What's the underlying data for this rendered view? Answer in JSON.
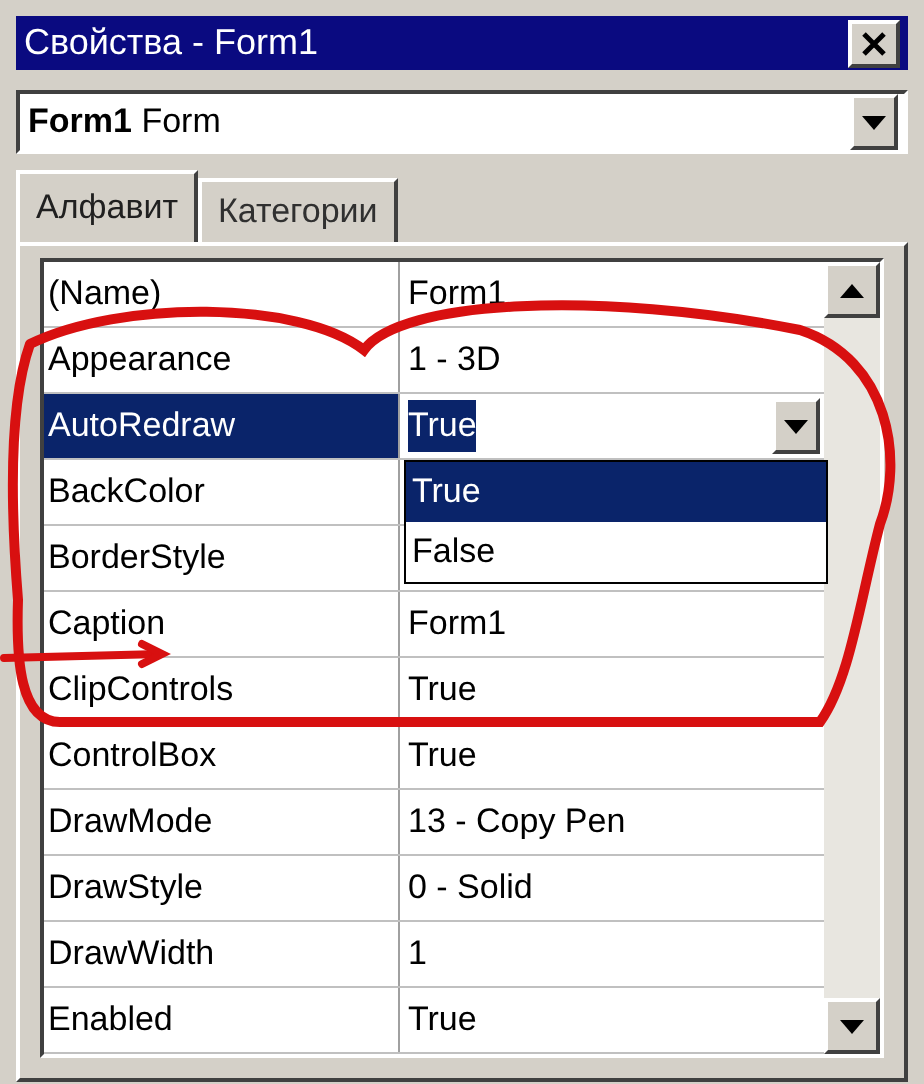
{
  "window": {
    "title": "Свойства - Form1"
  },
  "object_selector": {
    "name": "Form1",
    "type": "Form"
  },
  "tabs": [
    {
      "label": "Алфавит",
      "selected": true
    },
    {
      "label": "Категории",
      "selected": false
    }
  ],
  "properties": [
    {
      "name": "(Name)",
      "value": "Form1",
      "selected": false
    },
    {
      "name": "Appearance",
      "value": "1 - 3D",
      "selected": false
    },
    {
      "name": "AutoRedraw",
      "value": "True",
      "selected": true
    },
    {
      "name": "BackColor",
      "selected": false
    },
    {
      "name": "BorderStyle",
      "selected": false
    },
    {
      "name": "Caption",
      "value": "Form1",
      "selected": false
    },
    {
      "name": "ClipControls",
      "value": "True",
      "selected": false
    },
    {
      "name": "ControlBox",
      "value": "True",
      "selected": false
    },
    {
      "name": "DrawMode",
      "value": "13 - Copy Pen",
      "selected": false
    },
    {
      "name": "DrawStyle",
      "value": "0 - Solid",
      "selected": false
    },
    {
      "name": "DrawWidth",
      "value": "1",
      "selected": false
    },
    {
      "name": "Enabled",
      "value": "True",
      "selected": false
    }
  ],
  "dropdown": {
    "options": [
      {
        "label": "True",
        "selected": true
      },
      {
        "label": "False",
        "selected": false
      }
    ]
  }
}
